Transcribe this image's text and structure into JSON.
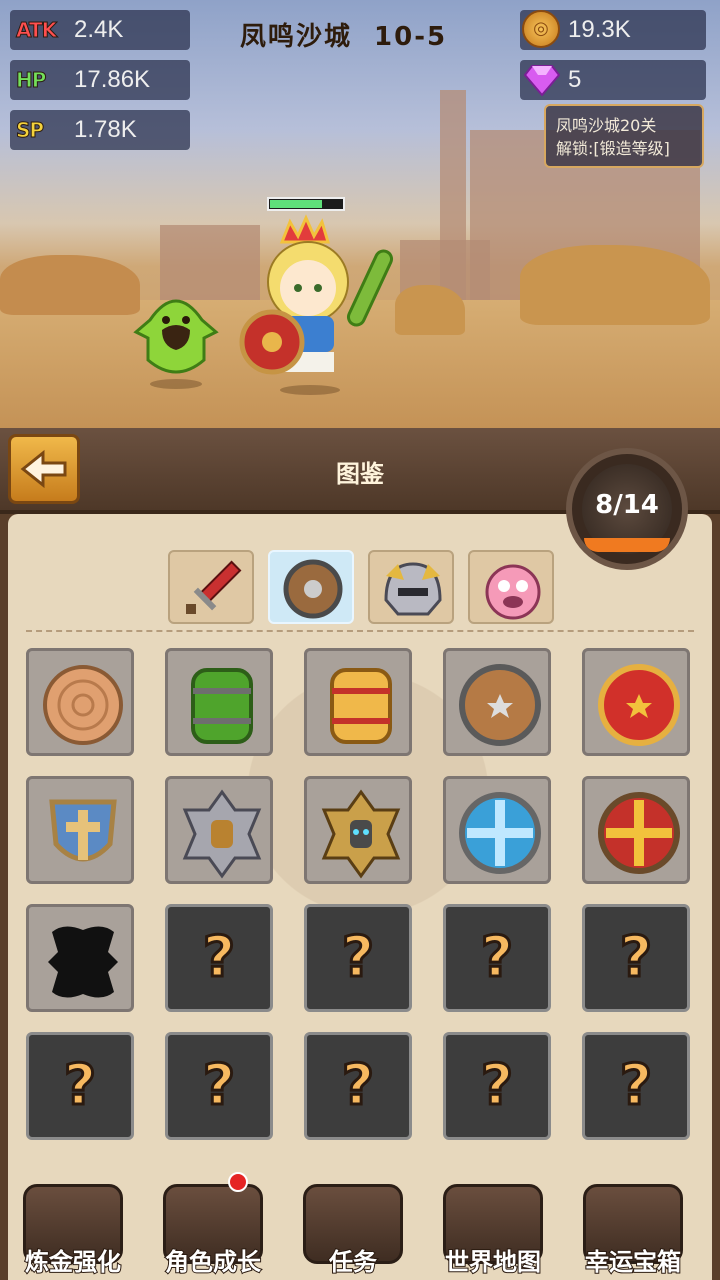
{
  "hud": {
    "atk": {
      "label": "ATK",
      "value": "2.4K",
      "color": "#ff4f4f"
    },
    "hp": {
      "label": "HP",
      "value": "17.86K",
      "color": "#74e05a"
    },
    "sp": {
      "label": "SP",
      "value": "1.78K",
      "color": "#f4d23c"
    },
    "stage_name": "凤鸣沙城",
    "stage_level": "10-5",
    "gold": "19.3K",
    "gems": "5",
    "unlock_line1": "凤鸣沙城20关",
    "unlock_line2": "解锁:[锻造等级]"
  },
  "panel": {
    "title": "图鉴",
    "progress": "8/14",
    "tabs": [
      {
        "name": "sword-icon",
        "selected": false
      },
      {
        "name": "shield-icon",
        "selected": true
      },
      {
        "name": "helmet-icon",
        "selected": false
      },
      {
        "name": "pet-icon",
        "selected": false
      }
    ],
    "collection": [
      {
        "icon": "wood-shield-icon",
        "unlocked": true
      },
      {
        "icon": "green-barrel-shield-icon",
        "unlocked": true
      },
      {
        "icon": "gold-barrel-shield-icon",
        "unlocked": true
      },
      {
        "icon": "round-star-shield-icon",
        "unlocked": true
      },
      {
        "icon": "red-star-shield-icon",
        "unlocked": true
      },
      {
        "icon": "cross-shield-icon",
        "unlocked": true
      },
      {
        "icon": "silver-spiked-shield-icon",
        "unlocked": true
      },
      {
        "icon": "gold-spiked-shield-icon",
        "unlocked": true
      },
      {
        "icon": "blue-cross-shield-icon",
        "unlocked": true
      },
      {
        "icon": "red-cross-shield-icon",
        "unlocked": true
      },
      {
        "icon": "silhouette-shield-icon",
        "unlocked": true
      },
      {
        "icon": "?",
        "unlocked": false
      },
      {
        "icon": "?",
        "unlocked": false
      },
      {
        "icon": "?",
        "unlocked": false
      },
      {
        "icon": "?",
        "unlocked": false
      },
      {
        "icon": "?",
        "unlocked": false
      },
      {
        "icon": "?",
        "unlocked": false
      },
      {
        "icon": "?",
        "unlocked": false
      },
      {
        "icon": "?",
        "unlocked": false
      },
      {
        "icon": "?",
        "unlocked": false
      }
    ]
  },
  "nav": [
    {
      "label": "炼金强化",
      "icon": "anvil-icon"
    },
    {
      "label": "角色成长",
      "icon": "character-icon",
      "badge": true
    },
    {
      "label": "任务",
      "icon": "quest-book-icon"
    },
    {
      "label": "世界地图",
      "icon": "map-scroll-icon"
    },
    {
      "label": "幸运宝箱",
      "icon": "locked-chest-icon"
    }
  ]
}
